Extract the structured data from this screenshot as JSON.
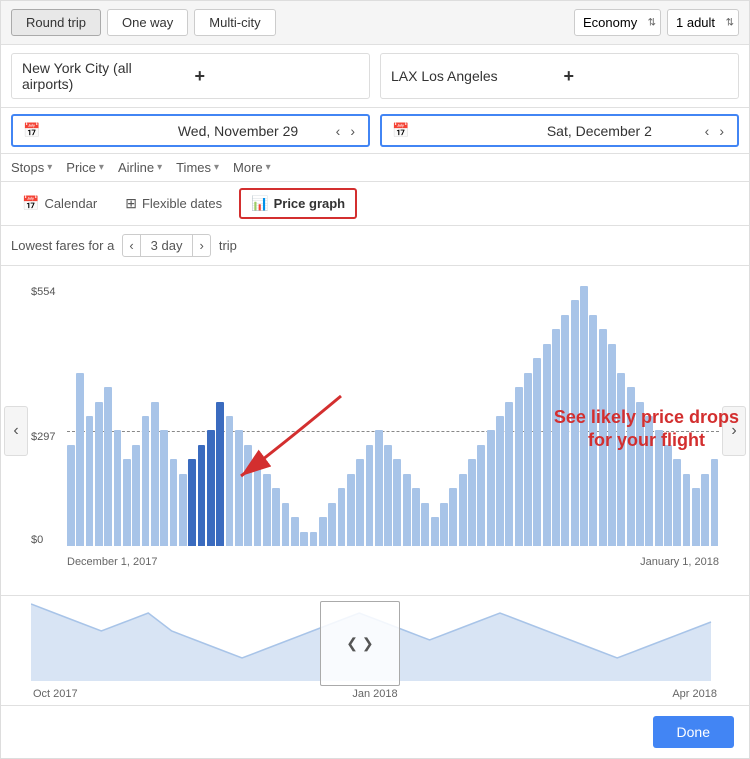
{
  "tripTypes": [
    "Round trip",
    "One way",
    "Multi-city"
  ],
  "activeTripType": "Round trip",
  "cabinClass": "Economy",
  "passengers": "1 adult",
  "origin": "New York City (all airports)",
  "destination": "LAX Los Angeles",
  "departDate": "Wed, November 29",
  "returnDate": "Sat, December 2",
  "filters": [
    "Stops",
    "Price",
    "Airline",
    "Times",
    "More"
  ],
  "viewOptions": {
    "calendar": "Calendar",
    "flexible": "Flexible dates",
    "priceGraph": "Price graph"
  },
  "faresLabel": "Lowest fares for a",
  "tripDays": "3 day",
  "tripSuffix": "trip",
  "priceLabels": {
    "top": "$554",
    "mid": "$297",
    "bottom": "$0"
  },
  "xLabels": {
    "left": "December 1, 2017",
    "right": "January 1, 2018"
  },
  "miniXLabels": [
    "Oct 2017",
    "Jan 2018",
    "Apr 2018"
  ],
  "annotation": "See likely price drops\nfor your flight",
  "doneLabel": "Done",
  "bars": [
    35,
    60,
    45,
    50,
    55,
    40,
    30,
    35,
    45,
    50,
    40,
    30,
    25,
    30,
    35,
    40,
    50,
    45,
    40,
    35,
    30,
    25,
    20,
    15,
    10,
    5,
    5,
    10,
    15,
    20,
    25,
    30,
    35,
    40,
    35,
    30,
    25,
    20,
    15,
    10,
    15,
    20,
    25,
    30,
    35,
    40,
    45,
    50,
    55,
    60,
    65,
    70,
    75,
    80,
    85,
    90,
    80,
    75,
    70,
    60,
    55,
    50,
    45,
    40,
    35,
    30,
    25,
    20,
    25,
    30
  ],
  "selectedBars": [
    13,
    14,
    15,
    16
  ],
  "miniBarData": [
    40,
    35,
    30,
    25,
    30,
    35,
    25,
    20,
    15,
    10,
    15,
    20,
    25,
    30,
    35,
    30,
    25,
    20,
    25,
    30,
    35,
    30,
    25,
    20,
    15,
    10,
    15,
    20,
    25,
    30
  ]
}
